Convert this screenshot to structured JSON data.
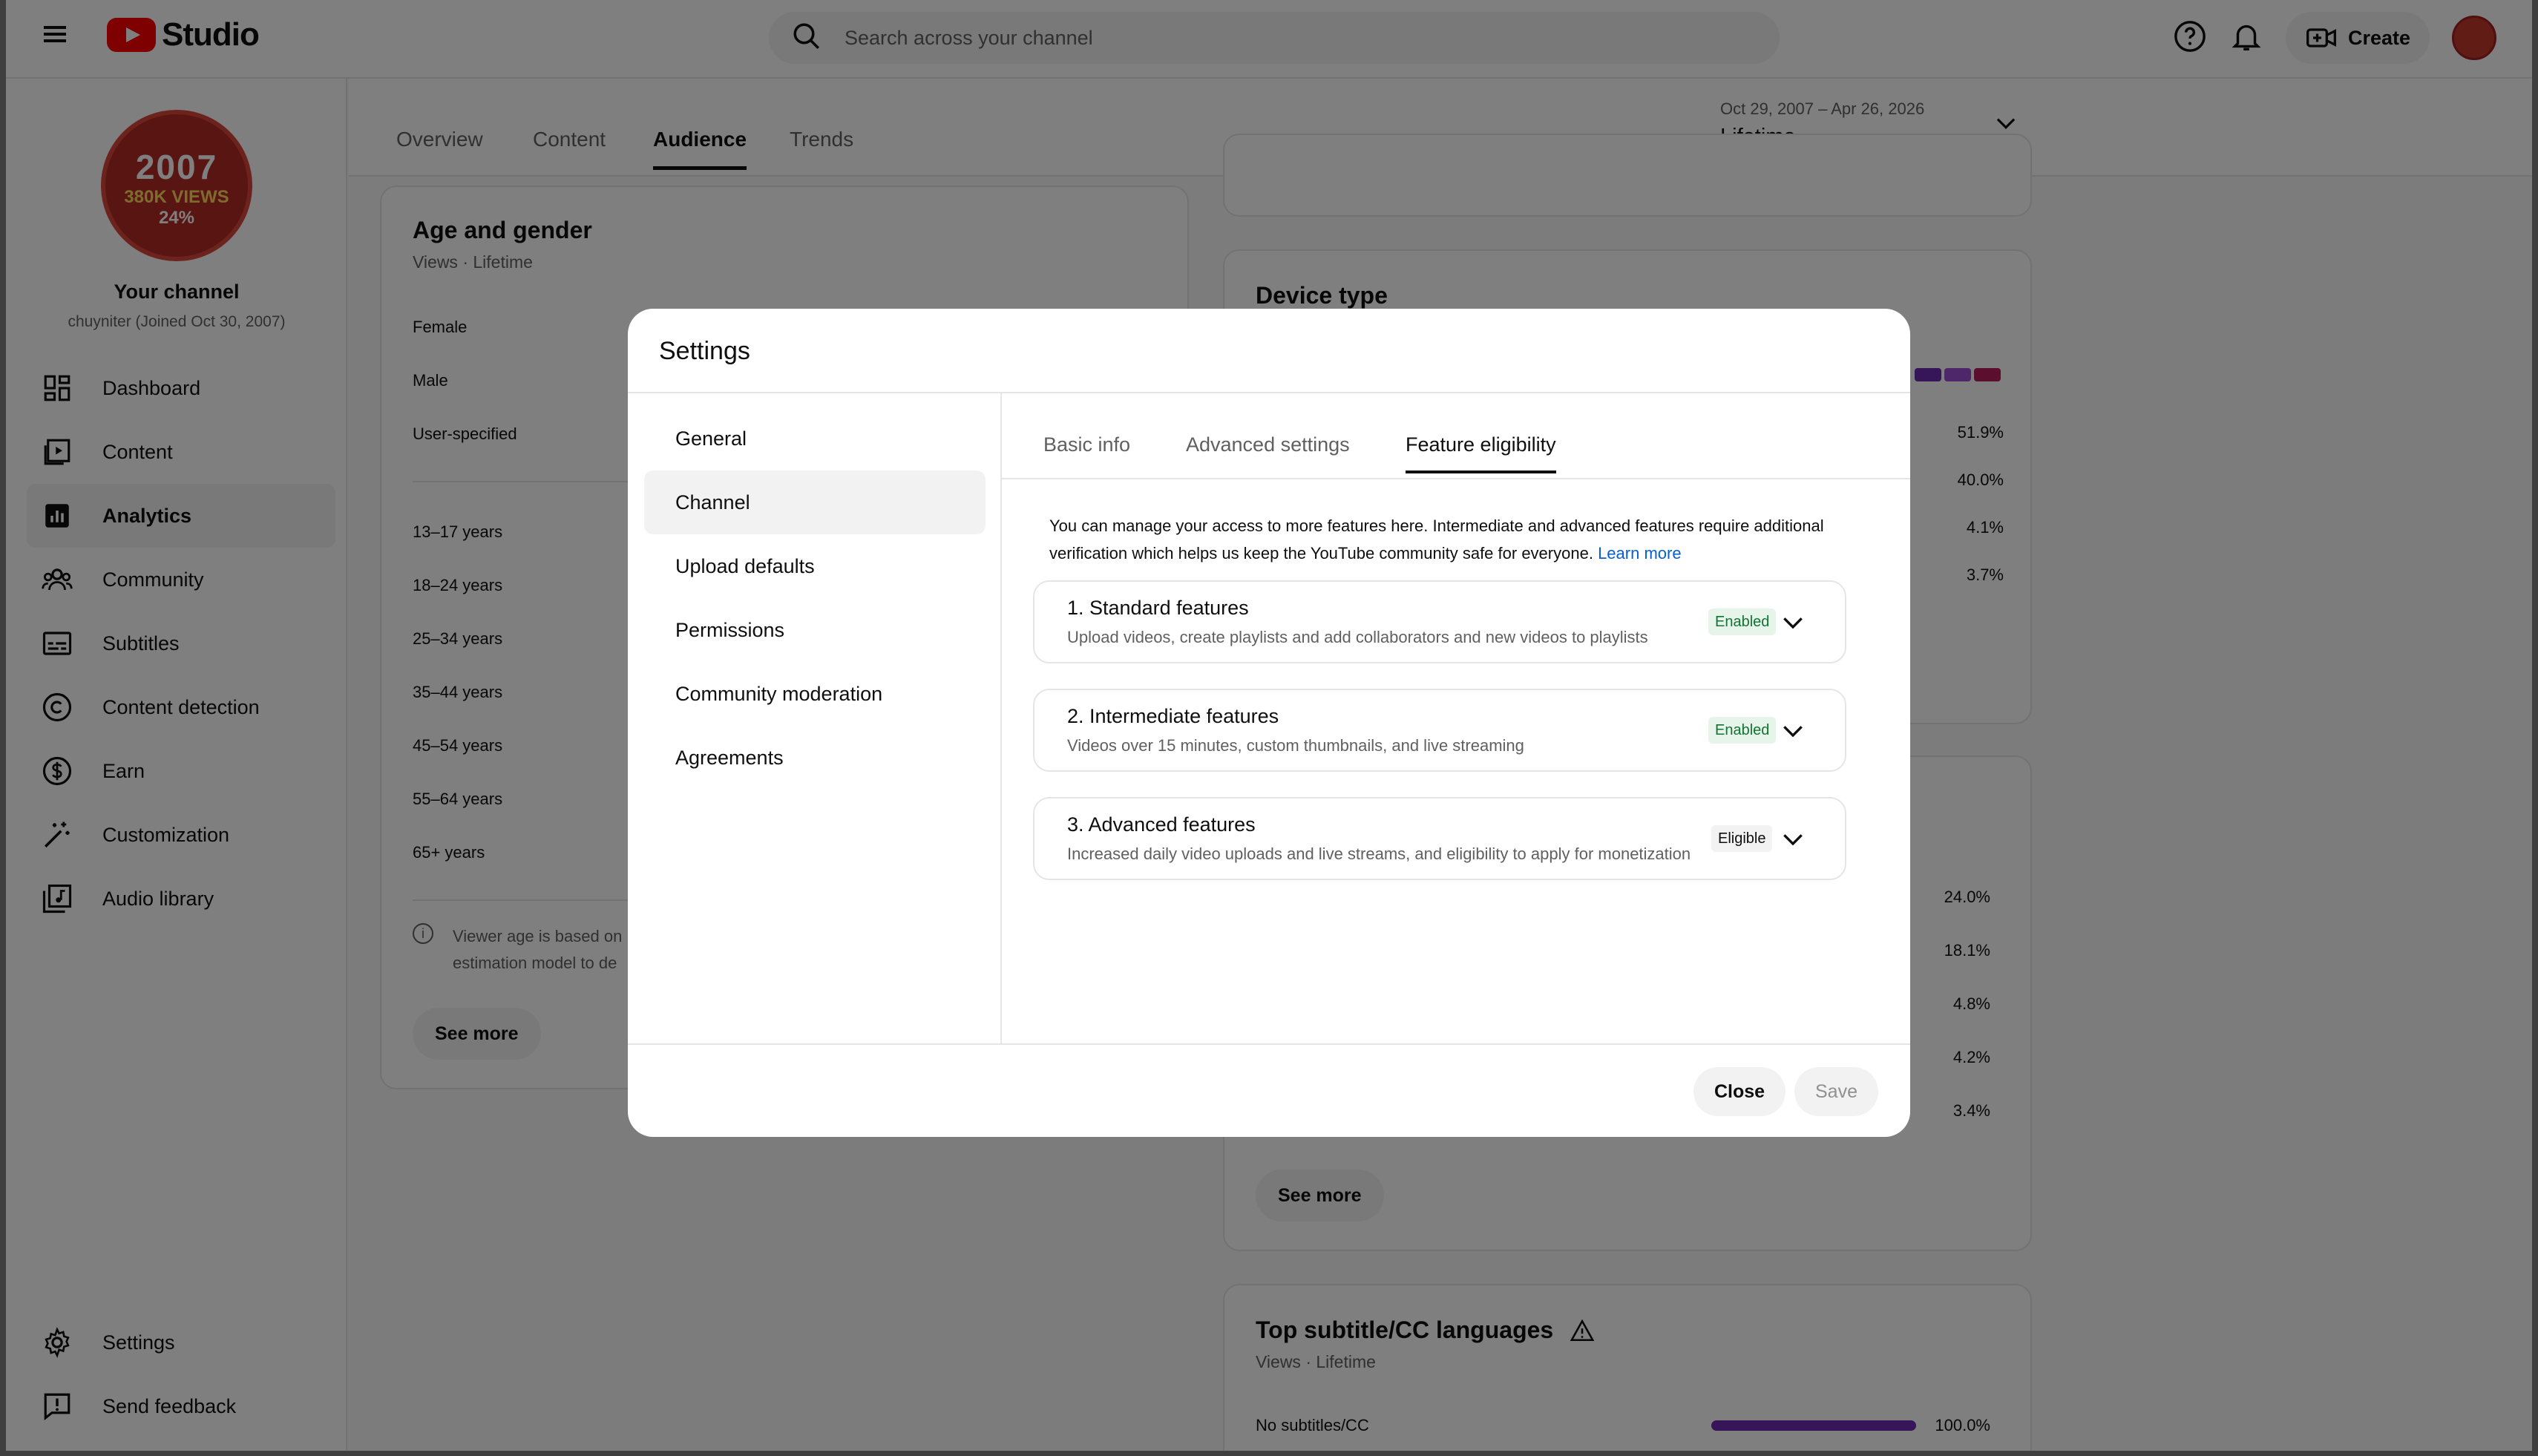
{
  "app": {
    "logo_text": "Studio"
  },
  "search": {
    "placeholder": "Search across your channel"
  },
  "topbar": {
    "create_label": "Create"
  },
  "channel": {
    "avatar_year": "2007",
    "avatar_views": "380K VIEWS",
    "avatar_pct": "24%",
    "name": "Your channel",
    "subtitle": "chuyniter (Joined Oct 30, 2007)"
  },
  "sidebar": {
    "items": [
      {
        "label": "Dashboard",
        "icon": "dashboard-icon"
      },
      {
        "label": "Content",
        "icon": "content-icon"
      },
      {
        "label": "Analytics",
        "icon": "analytics-icon"
      },
      {
        "label": "Community",
        "icon": "community-icon"
      },
      {
        "label": "Subtitles",
        "icon": "subtitles-icon"
      },
      {
        "label": "Content detection",
        "icon": "copyright-icon"
      },
      {
        "label": "Earn",
        "icon": "dollar-icon"
      },
      {
        "label": "Customization",
        "icon": "magic-wand-icon"
      },
      {
        "label": "Audio library",
        "icon": "audio-library-icon"
      }
    ],
    "bottom_items": [
      {
        "label": "Settings",
        "icon": "gear-icon"
      },
      {
        "label": "Send feedback",
        "icon": "feedback-icon"
      }
    ]
  },
  "analytics_tabs": [
    "Overview",
    "Content",
    "Audience",
    "Trends"
  ],
  "date_range": {
    "range": "Oct 29, 2007 – Apr 26, 2026",
    "label": "Lifetime"
  },
  "age_gender": {
    "title": "Age and gender",
    "subtitle": "Views · Lifetime",
    "genders": [
      "Female",
      "Male",
      "User-specified"
    ],
    "ages": [
      "13–17 years",
      "18–24 years",
      "25–34 years",
      "35–44 years",
      "45–54 years",
      "55–64 years",
      "65+ years"
    ],
    "note": "Viewer age is based on estimation model to de",
    "see_more": "See more"
  },
  "device_type": {
    "title": "Device type",
    "values": [
      "51.9%",
      "40.0%",
      "4.1%",
      "3.7%"
    ]
  },
  "geography_card": {
    "values": [
      "24.0%",
      "18.1%",
      "4.8%",
      "4.2%",
      "3.4%"
    ],
    "see_more": "See more"
  },
  "subtitle_card": {
    "title": "Top subtitle/CC languages",
    "subtitle": "Views · Lifetime",
    "row_label": "No subtitles/CC",
    "row_value": "100.0%",
    "row_fraction": 1.0
  },
  "dialog": {
    "title": "Settings",
    "nav": [
      "General",
      "Channel",
      "Upload defaults",
      "Permissions",
      "Community moderation",
      "Agreements"
    ],
    "active_nav": "Channel",
    "tabs": [
      "Basic info",
      "Advanced settings",
      "Feature eligibility"
    ],
    "active_tab": "Feature eligibility",
    "intro": "You can manage your access to more features here. Intermediate and advanced features require additional verification which helps us keep the YouTube community safe for everyone.",
    "learn_more": "Learn more",
    "features": [
      {
        "title": "1. Standard features",
        "desc": "Upload videos, create playlists and add collaborators and new videos to playlists",
        "status": "Enabled"
      },
      {
        "title": "2. Intermediate features",
        "desc": "Videos over 15 minutes, custom thumbnails, and live streaming",
        "status": "Enabled"
      },
      {
        "title": "3. Advanced features",
        "desc": "Increased daily video uploads and live streams, and eligibility to apply for monetization",
        "status": "Eligible"
      }
    ],
    "close_label": "Close",
    "save_label": "Save"
  },
  "colors": {
    "accent": "#6d2ab0",
    "brand_red": "#ff0000",
    "link": "#065fd4",
    "enabled_green": "#137333"
  }
}
